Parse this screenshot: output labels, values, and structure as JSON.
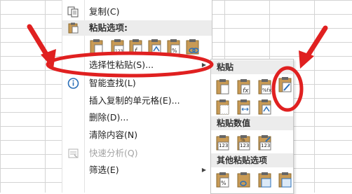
{
  "menu": {
    "copy_label": "复制(C)",
    "paste_options_header": "粘贴选项:",
    "paste_special_label": "选择性粘贴(S)...",
    "smart_lookup_label": "智能查找(L)",
    "insert_copied_label": "插入复制的单元格(E)...",
    "delete_label": "删除(D)...",
    "clear_label": "清除内容(N)",
    "quick_analysis_label": "快速分析(Q)",
    "filter_label": "筛选(E)"
  },
  "submenu": {
    "paste_header": "粘贴",
    "paste_values_header": "粘贴数值",
    "other_paste_header": "其他粘贴选项",
    "values_tag": "123"
  },
  "colors": {
    "annotation_red": "#e02020",
    "section_bg": "#ececec",
    "clipboard_tan": "#c89a55",
    "highlight_blue": "#2a6fb8"
  }
}
